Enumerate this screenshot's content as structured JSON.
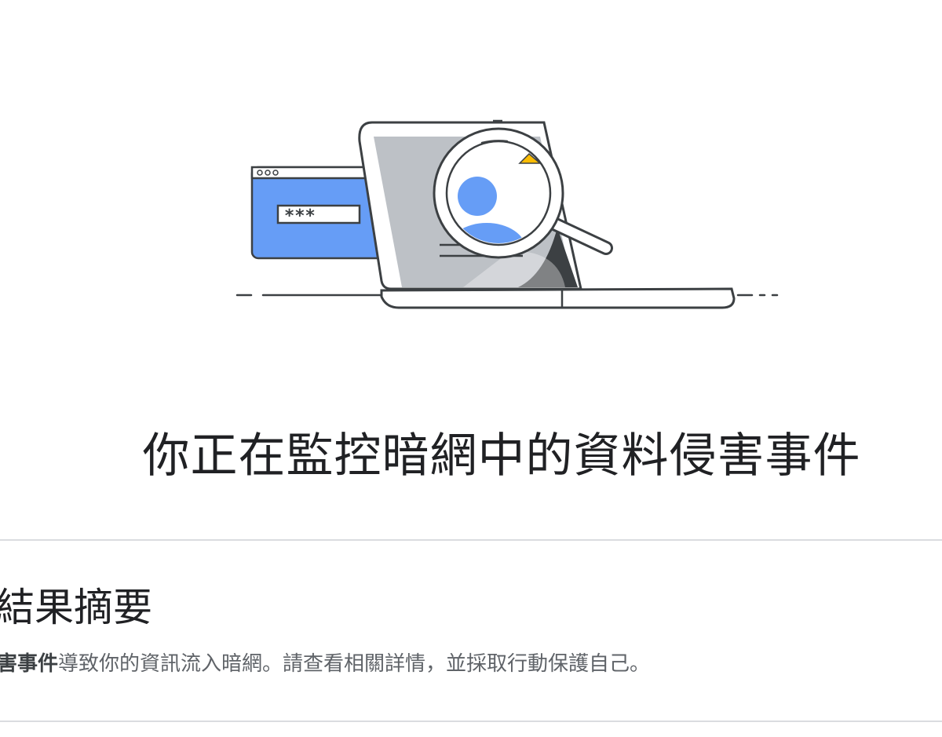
{
  "hero": {
    "password_mask": "***"
  },
  "page_title": "你正在監控暗網中的資料侵害事件",
  "summary": {
    "heading": "結果摘要",
    "highlight": "害事件",
    "text": "導致你的資訊流入暗網。請查看相關詳情，並採取行動保護自己。"
  },
  "colors": {
    "blue": "#669df6",
    "gray_screen": "#bdc1c6",
    "dark": "#3c4043",
    "yellow": "#fbbc04"
  }
}
